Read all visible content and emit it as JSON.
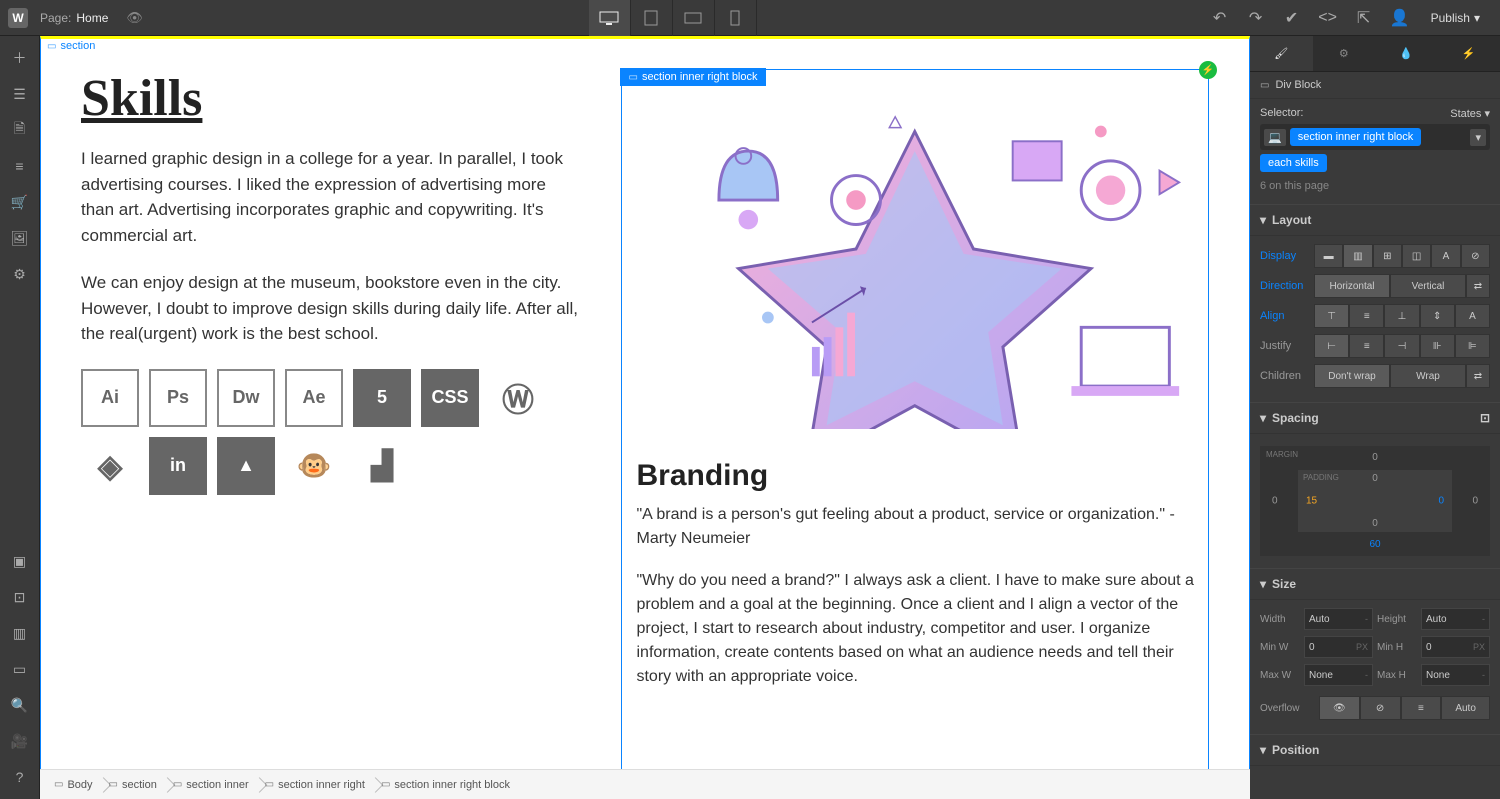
{
  "topbar": {
    "page_label": "Page:",
    "page_name": "Home",
    "publish_label": "Publish"
  },
  "left_tools": [
    "add",
    "layers",
    "pages",
    "cms",
    "ecommerce",
    "assets",
    "settings"
  ],
  "left_tools_bottom": [
    "audit",
    "grid",
    "xray",
    "guides",
    "search",
    "video",
    "help"
  ],
  "canvas": {
    "section_tag": "section",
    "skills_title": "Skills",
    "skills_p1": "I learned graphic design in a college for a year. In parallel, I took advertising courses. I liked the expression of advertising more than art. Advertising incorporates graphic and copywriting. It's commercial art.",
    "skills_p2": "We can enjoy design at the museum, bookstore even in the city. However, I doubt to improve design skills during daily life. After all, the real(urgent) work is the best school.",
    "skill_icons": [
      "Ai",
      "Ps",
      "Dw",
      "Ae",
      "5",
      "CSS",
      "W",
      "◈",
      "in",
      "▲",
      "@",
      "▮"
    ],
    "selected_label": "section inner right block",
    "brand_title": "Branding",
    "brand_p1": "\"A brand is a person's gut feeling about a product, service or organization.\" - Marty Neumeier",
    "brand_p2": "\"Why do you need a brand?\" I always ask a client. I have to make sure about a problem and a goal at the beginning. Once a client and I align a vector of the project,  I start to research about industry, competitor and user. I organize information, create contents based on what an audience needs and tell their story with an appropriate voice."
  },
  "breadcrumb": [
    "Body",
    "section",
    "section inner",
    "section inner right",
    "section inner right block"
  ],
  "style_panel": {
    "element_type": "Div Block",
    "selector_label": "Selector:",
    "states_label": "States",
    "classes": [
      "section inner right block",
      "each skills"
    ],
    "count": "6 on this page",
    "layout": {
      "header": "Layout",
      "display": "Display",
      "direction": "Direction",
      "direction_options": [
        "Horizontal",
        "Vertical"
      ],
      "align": "Align",
      "justify": "Justify",
      "children": "Children",
      "children_options": [
        "Don't wrap",
        "Wrap"
      ]
    },
    "spacing": {
      "header": "Spacing",
      "margin_label": "MARGIN",
      "padding_label": "PADDING",
      "margin": {
        "top": "0",
        "right": "0",
        "bottom": "60",
        "left": "0"
      },
      "padding": {
        "top": "0",
        "right": "0",
        "bottom": "0",
        "left": "15"
      }
    },
    "size": {
      "header": "Size",
      "width_label": "Width",
      "width": "Auto",
      "height_label": "Height",
      "height": "Auto",
      "minw_label": "Min W",
      "minw": "0",
      "minw_unit": "PX",
      "minh_label": "Min H",
      "minh": "0",
      "minh_unit": "PX",
      "maxw_label": "Max W",
      "maxw": "None",
      "maxh_label": "Max H",
      "maxh": "None",
      "overflow_label": "Overflow",
      "fit": "Auto"
    },
    "position_header": "Position"
  }
}
